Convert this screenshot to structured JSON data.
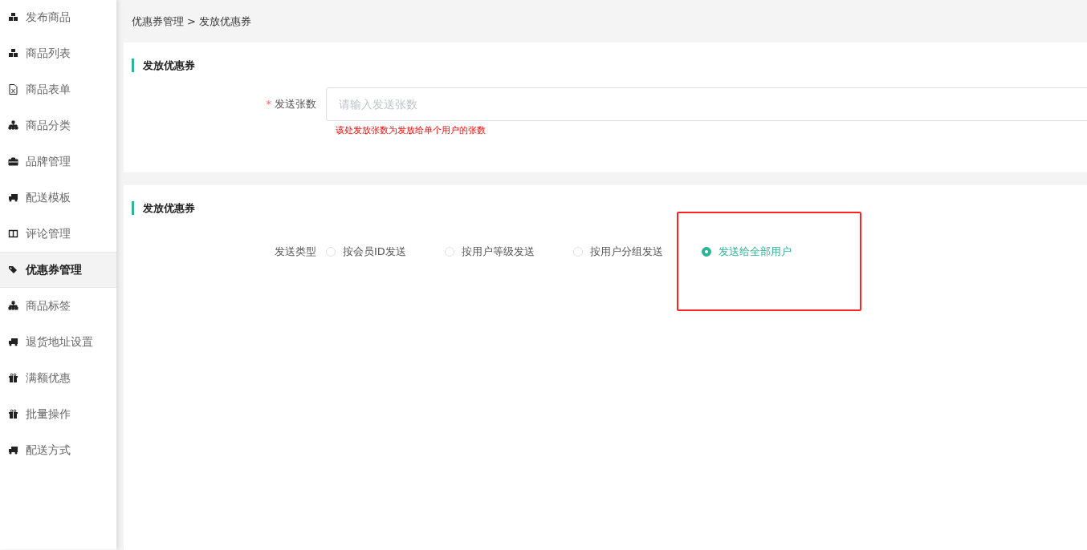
{
  "sidebar": {
    "items": [
      {
        "label": "发布商品",
        "selected": false
      },
      {
        "label": "商品列表",
        "selected": false
      },
      {
        "label": "商品表单",
        "selected": false
      },
      {
        "label": "商品分类",
        "selected": false
      },
      {
        "label": "品牌管理",
        "selected": false
      },
      {
        "label": "配送模板",
        "selected": false
      },
      {
        "label": "评论管理",
        "selected": false
      },
      {
        "label": "优惠券管理",
        "selected": true
      },
      {
        "label": "商品标签",
        "selected": false
      },
      {
        "label": "退货地址设置",
        "selected": false
      },
      {
        "label": "满额优惠",
        "selected": false
      },
      {
        "label": "批量操作",
        "selected": false
      },
      {
        "label": "配送方式",
        "selected": false
      }
    ]
  },
  "breadcrumb": {
    "parent": "优惠券管理",
    "separator": ">",
    "current": "发放优惠券"
  },
  "quantity_section": {
    "title": "发放优惠券",
    "field": {
      "label": "发送张数",
      "required_mark": "*",
      "placeholder": "请输入发送张数",
      "hint": "该处发放张数为发放给单个用户的张数"
    }
  },
  "type_section": {
    "title": "发放优惠券",
    "label": "发送类型",
    "options": [
      {
        "label": "按会员ID发送",
        "selected": false
      },
      {
        "label": "按用户等级发送",
        "selected": false
      },
      {
        "label": "按用户分组发送",
        "selected": false
      },
      {
        "label": "发送给全部用户",
        "selected": true
      }
    ]
  }
}
